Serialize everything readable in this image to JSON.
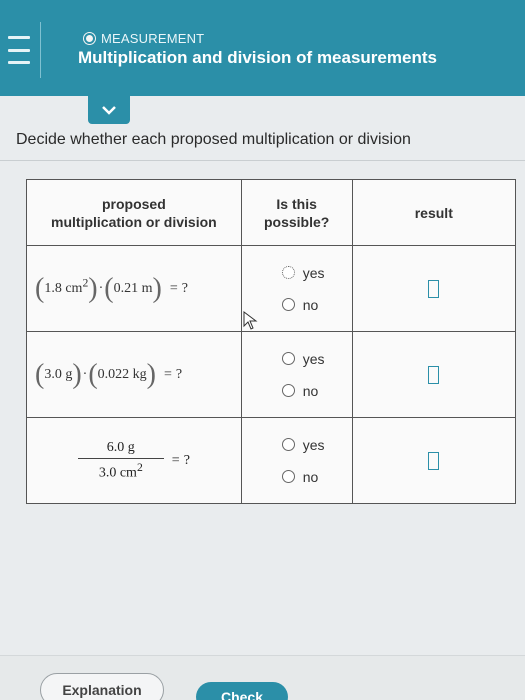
{
  "header": {
    "topic": "MEASUREMENT",
    "title": "Multiplication and division of measurements"
  },
  "instruction": "Decide whether each proposed multiplication or division",
  "table": {
    "headers": {
      "col1": [
        "proposed",
        "multiplication or division"
      ],
      "col2": [
        "Is this",
        "possible?"
      ],
      "col3": "result"
    },
    "rows": [
      {
        "a": "1.8 cm",
        "a_exp": "2",
        "b": "0.21 m",
        "op": "=",
        "q": "?",
        "yes": "yes",
        "no": "no"
      },
      {
        "a": "3.0 g",
        "b": "0.022 kg",
        "op": "=",
        "q": "?",
        "yes": "yes",
        "no": "no"
      },
      {
        "num": "6.0 g",
        "den": "3.0 cm",
        "den_exp": "2",
        "op": "=",
        "q": "?",
        "yes": "yes",
        "no": "no"
      }
    ]
  },
  "buttons": {
    "explanation": "Explanation",
    "check": "Check"
  },
  "colors": {
    "brand": "#2b8fa8"
  },
  "icons": [
    "menu-icon",
    "chevron-down-icon",
    "cursor-icon"
  ]
}
